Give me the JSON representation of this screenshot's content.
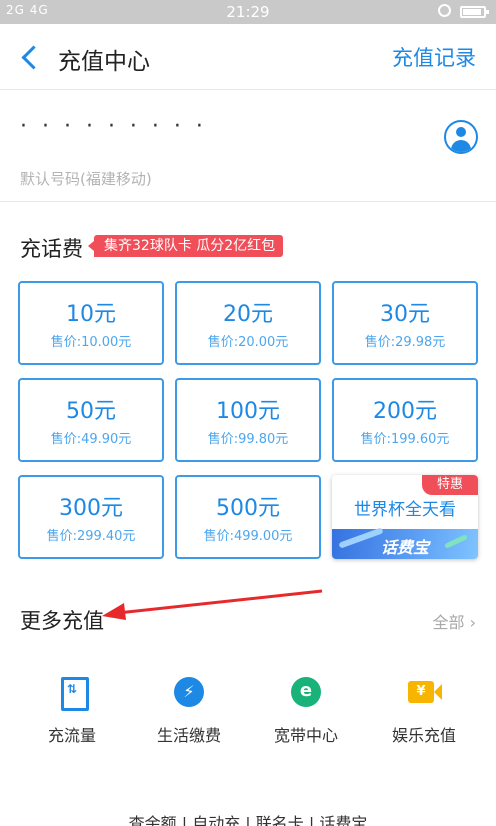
{
  "status_bar": {
    "signal": "2G 4G",
    "time": "21:29"
  },
  "nav": {
    "title": "充值中心",
    "record_link": "充值记录"
  },
  "phone": {
    "number": "· · ·   · ·   · ·   · ·",
    "default_note": "默认号码(福建移动)"
  },
  "topup": {
    "title": "充话费",
    "promo": "集齐32球队卡 瓜分2亿红包",
    "cards": [
      {
        "amount": "10元",
        "price": "售价:10.00元"
      },
      {
        "amount": "20元",
        "price": "售价:20.00元"
      },
      {
        "amount": "30元",
        "price": "售价:29.98元"
      },
      {
        "amount": "50元",
        "price": "售价:49.90元"
      },
      {
        "amount": "100元",
        "price": "售价:99.80元"
      },
      {
        "amount": "200元",
        "price": "售价:199.60元"
      },
      {
        "amount": "300元",
        "price": "售价:299.40元"
      },
      {
        "amount": "500元",
        "price": "售价:499.00元"
      }
    ],
    "special": {
      "tag": "特惠",
      "headline": "世界杯全天看",
      "brand": "话费宝"
    }
  },
  "more": {
    "title": "更多充值",
    "all_link": "全部",
    "services": [
      {
        "label": "充流量",
        "icon": "data-flow-icon",
        "glyph": "⇅"
      },
      {
        "label": "生活缴费",
        "icon": "lightning-icon",
        "glyph": "⚡"
      },
      {
        "label": "宽带中心",
        "icon": "broadband-e-icon",
        "glyph": "e"
      },
      {
        "label": "娱乐充值",
        "icon": "yen-camera-icon",
        "glyph": "¥"
      }
    ]
  },
  "footer": {
    "links": "查余额 | 自动充 | 联名卡 | 话费宝"
  },
  "colors": {
    "accent": "#1e88e5",
    "promo": "#f04f5a",
    "status_bar": "#c9c9c9"
  }
}
